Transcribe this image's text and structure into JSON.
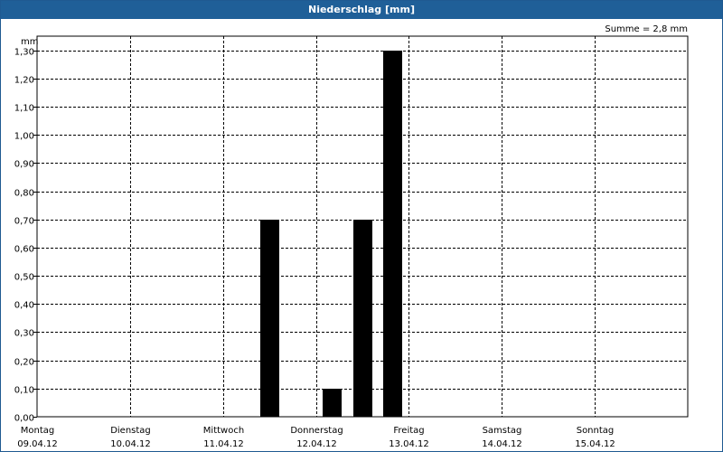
{
  "window": {
    "title": "Niederschlag [mm]"
  },
  "summary": {
    "total_label": "Summe = 2,8 mm"
  },
  "chart_data": {
    "type": "bar",
    "title": "Niederschlag [mm]",
    "ylabel": "mm",
    "ylim": [
      0,
      1.35
    ],
    "yticks": [
      "0,00",
      "0,10",
      "0,20",
      "0,30",
      "0,40",
      "0,50",
      "0,60",
      "0,70",
      "0,80",
      "0,90",
      "1,00",
      "1,10",
      "1,20",
      "1,30"
    ],
    "x_days": [
      {
        "day": "Montag",
        "date": "09.04.12"
      },
      {
        "day": "Dienstag",
        "date": "10.04.12"
      },
      {
        "day": "Mittwoch",
        "date": "11.04.12"
      },
      {
        "day": "Donnerstag",
        "date": "12.04.12"
      },
      {
        "day": "Freitag",
        "date": "13.04.12"
      },
      {
        "day": "Samstag",
        "date": "14.04.12"
      },
      {
        "day": "Sonntag",
        "date": "15.04.12"
      }
    ],
    "x_unit": "days",
    "bars": [
      {
        "day_offset": 2.5,
        "value": 0.7
      },
      {
        "day_offset": 3.17,
        "value": 0.1
      },
      {
        "day_offset": 3.5,
        "value": 0.7
      },
      {
        "day_offset": 3.83,
        "value": 1.3
      }
    ],
    "grid": true,
    "bar_color": "#000000"
  }
}
